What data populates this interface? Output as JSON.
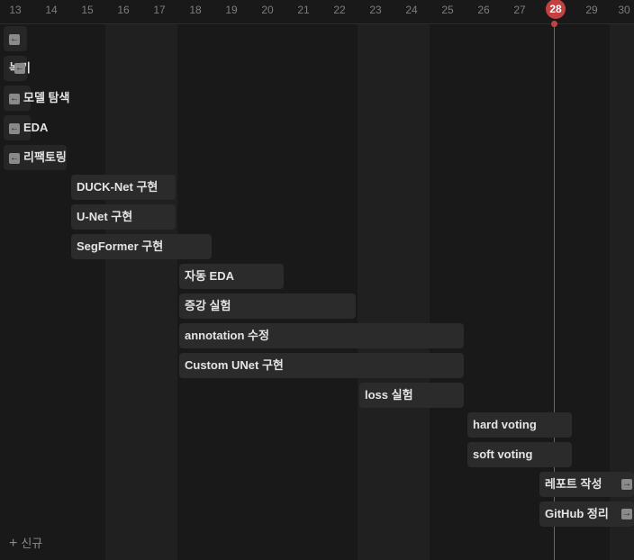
{
  "calendar": {
    "days": [
      "13",
      "14",
      "15",
      "16",
      "17",
      "18",
      "19",
      "20",
      "21",
      "22",
      "23",
      "24",
      "25",
      "26",
      "27",
      "28",
      "29",
      "30"
    ],
    "today": "28"
  },
  "tasks": [
    {
      "label": ""
    },
    {
      "label": "녹기"
    },
    {
      "label": "모델 탐색"
    },
    {
      "label": "EDA"
    },
    {
      "label": "리팩토링"
    },
    {
      "label": "DUCK-Net 구현"
    },
    {
      "label": "U-Net 구현"
    },
    {
      "label": "SegFormer 구현"
    },
    {
      "label": "자동 EDA"
    },
    {
      "label": "증강 실험"
    },
    {
      "label": "annotation 수정"
    },
    {
      "label": "Custom UNet 구현"
    },
    {
      "label": "loss 실험"
    },
    {
      "label": "hard voting"
    },
    {
      "label": "soft voting"
    },
    {
      "label": "레포트 작성"
    },
    {
      "label": "GitHub 정리"
    }
  ],
  "new_button": {
    "label": "신규"
  },
  "colors": {
    "today": "#c44141",
    "bar": "#2b2b2b",
    "background": "#191919"
  },
  "icons": {
    "left": "arrow-left-icon",
    "right": "arrow-right-icon",
    "add": "plus-icon"
  }
}
